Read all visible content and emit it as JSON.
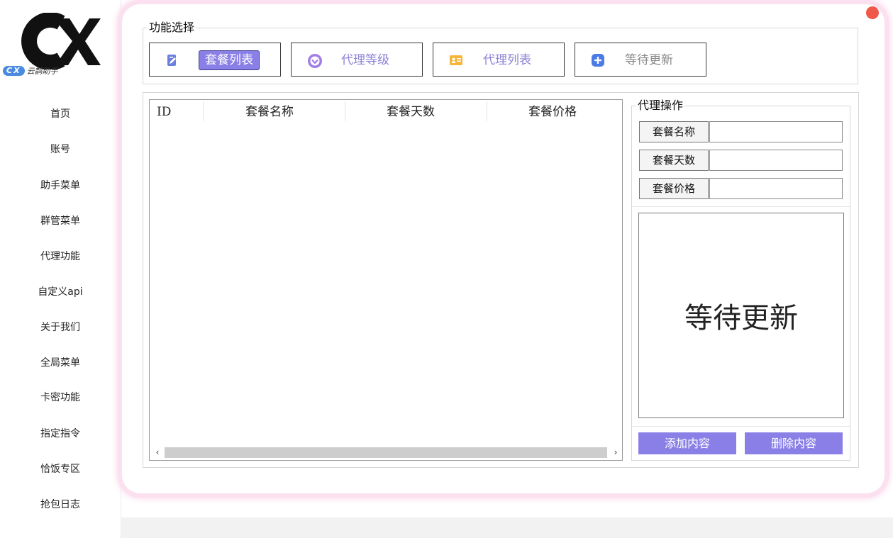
{
  "sidebar": {
    "brand_pill": "CX",
    "brand_text": "云鹊助手",
    "items": [
      "首页",
      "账号",
      "助手菜单",
      "群管菜单",
      "代理功能",
      "自定义api",
      "关于我们",
      "全局菜单",
      "卡密功能",
      "指定指令",
      "恰饭专区",
      "抢包日志"
    ]
  },
  "func_select": {
    "title": "功能选择",
    "buttons": [
      {
        "label": "套餐列表",
        "icon": "edit-icon",
        "active": true
      },
      {
        "label": "代理等级",
        "icon": "heart-badge-icon"
      },
      {
        "label": "代理列表",
        "icon": "id-card-icon"
      },
      {
        "label": "等待更新",
        "icon": "plus-icon",
        "muted": true
      }
    ]
  },
  "table": {
    "columns": [
      "ID",
      "套餐名称",
      "套餐天数",
      "套餐价格"
    ],
    "rows": []
  },
  "agent_ops": {
    "title": "代理操作",
    "fields": [
      {
        "label": "套餐名称",
        "value": ""
      },
      {
        "label": "套餐天数",
        "value": ""
      },
      {
        "label": "套餐价格",
        "value": ""
      }
    ],
    "placeholder_text": "等待更新",
    "add_label": "添加内容",
    "delete_label": "删除内容"
  },
  "colors": {
    "accent": "#8a7fe6",
    "card_glow": "#f7cde4",
    "close_dot": "#f0584a",
    "brand_blue": "#4a8be0"
  }
}
